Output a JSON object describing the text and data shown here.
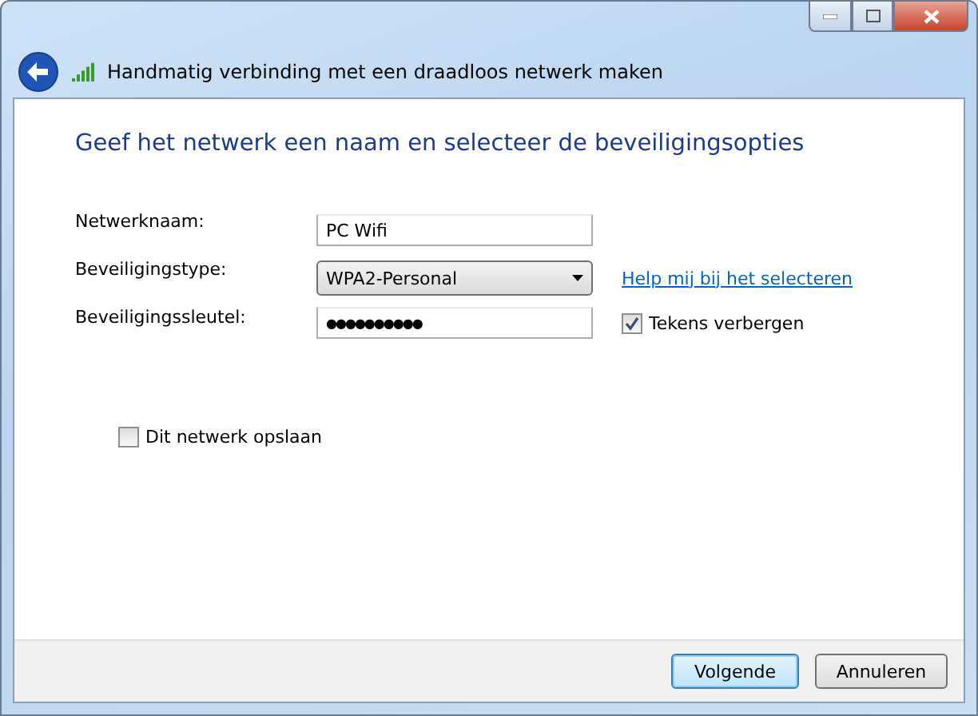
{
  "window": {
    "title": "Handmatig verbinding met een draadloos netwerk maken"
  },
  "heading": "Geef het netwerk een naam en selecteer de beveiligingsopties",
  "fields": [
    {
      "kind": "text",
      "label": "Netwerknaam:",
      "value": "PC Wifi"
    },
    {
      "kind": "select",
      "label": "Beveiligingstype:",
      "value": "WPA2-Personal",
      "link": "Help mij bij het selecteren"
    },
    {
      "kind": "password",
      "label": "Beveiligingssleutel:",
      "value": "●●●●●●●●●●",
      "checkbox": {
        "label": "Tekens verbergen",
        "checked": true
      }
    }
  ],
  "save_option": {
    "label": "Dit netwerk opslaan",
    "checked": false
  },
  "buttons": [
    {
      "label": "Volgende",
      "default": true
    },
    {
      "label": "Annuleren",
      "default": false
    }
  ]
}
